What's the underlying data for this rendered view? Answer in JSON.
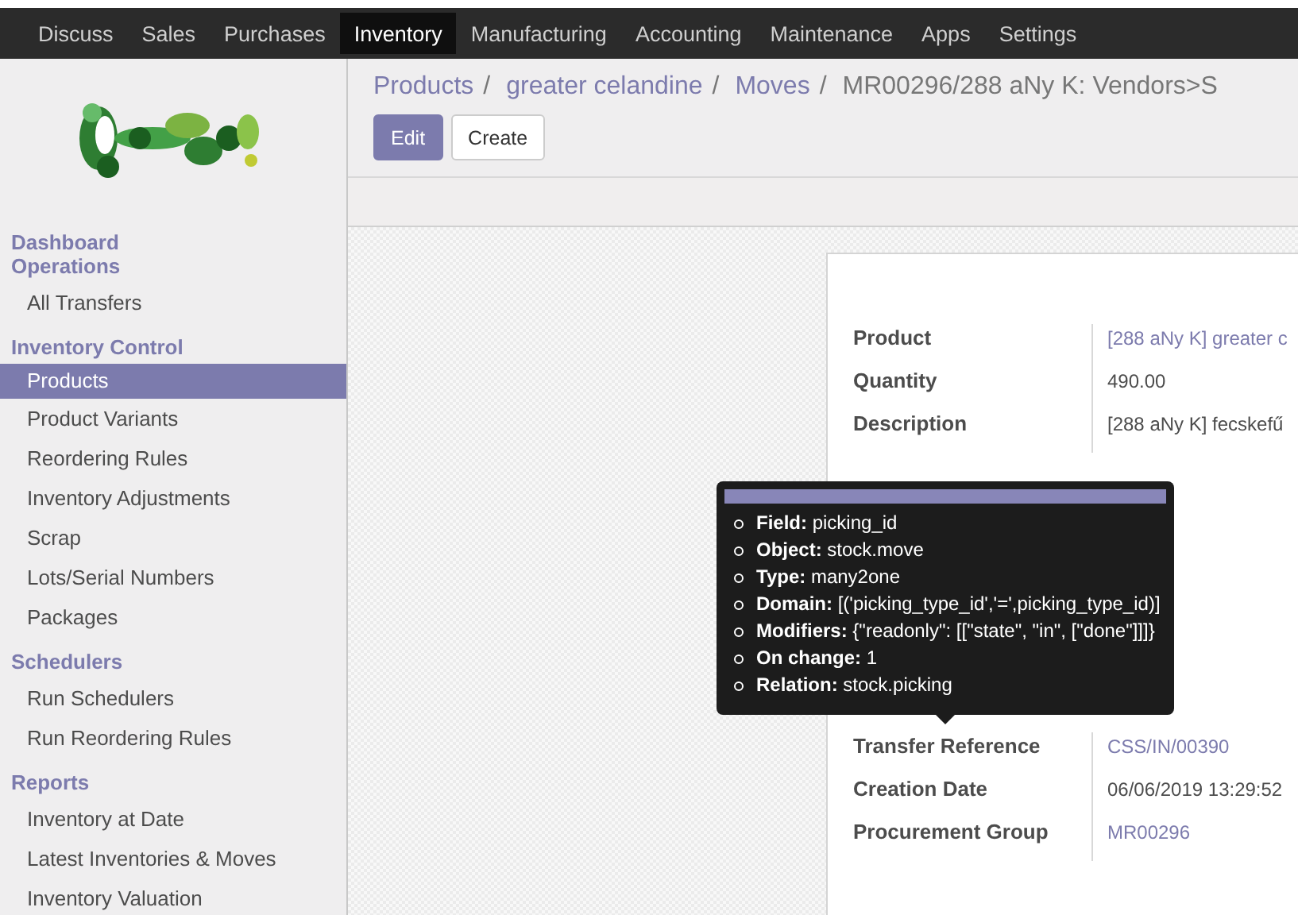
{
  "top_menu": [
    {
      "label": "Discuss",
      "selected": false
    },
    {
      "label": "Sales",
      "selected": false
    },
    {
      "label": "Purchases",
      "selected": false
    },
    {
      "label": "Inventory",
      "selected": true
    },
    {
      "label": "Manufacturing",
      "selected": false
    },
    {
      "label": "Accounting",
      "selected": false
    },
    {
      "label": "Maintenance",
      "selected": false
    },
    {
      "label": "Apps",
      "selected": false
    },
    {
      "label": "Settings",
      "selected": false
    }
  ],
  "sidebar": {
    "sections": [
      {
        "title": "Dashboard"
      },
      {
        "title": "Operations",
        "items": [
          {
            "label": "All Transfers",
            "selected": false
          }
        ]
      },
      {
        "title": "Inventory Control",
        "items": [
          {
            "label": "Products",
            "selected": true
          },
          {
            "label": "Product Variants",
            "selected": false
          },
          {
            "label": "Reordering Rules",
            "selected": false
          },
          {
            "label": "Inventory Adjustments",
            "selected": false
          },
          {
            "label": "Scrap",
            "selected": false
          },
          {
            "label": "Lots/Serial Numbers",
            "selected": false
          },
          {
            "label": "Packages",
            "selected": false
          }
        ]
      },
      {
        "title": "Schedulers",
        "items": [
          {
            "label": "Run Schedulers",
            "selected": false
          },
          {
            "label": "Run Reordering Rules",
            "selected": false
          }
        ]
      },
      {
        "title": "Reports",
        "items": [
          {
            "label": "Inventory at Date",
            "selected": false
          },
          {
            "label": "Latest Inventories & Moves",
            "selected": false
          },
          {
            "label": "Inventory Valuation",
            "selected": false
          }
        ]
      }
    ]
  },
  "breadcrumb": [
    {
      "label": "Products",
      "kind": "link"
    },
    {
      "label": "/",
      "kind": "separator"
    },
    {
      "label": "greater celandine",
      "kind": "link"
    },
    {
      "label": "/",
      "kind": "separator"
    },
    {
      "label": "Moves",
      "kind": "link"
    },
    {
      "label": "/",
      "kind": "separator"
    },
    {
      "label": "MR00296/288 aNy K: Vendors>S",
      "kind": "current"
    }
  ],
  "buttons": [
    {
      "label": "Edit",
      "kind": "primary"
    },
    {
      "label": "Create",
      "kind": "secondary"
    }
  ],
  "form": {
    "groups": [
      {
        "fields": [
          {
            "label": "Product",
            "value": "[288 aNy K] greater c",
            "kind": "link"
          },
          {
            "label": "Quantity",
            "value": "490.00",
            "kind": "text"
          },
          {
            "label": "Description",
            "value": "[288 aNy K] fecskefű",
            "kind": "text"
          }
        ]
      },
      {
        "fields": [
          {
            "label": "Transfer Reference",
            "value": "CSS/IN/00390",
            "kind": "link"
          },
          {
            "label": "Creation Date",
            "value": "06/06/2019 13:29:52",
            "kind": "text"
          },
          {
            "label": "Procurement Group",
            "value": "MR00296",
            "kind": "link"
          }
        ]
      }
    ]
  },
  "tooltip": {
    "items": [
      {
        "key": "Field:",
        "value": "picking_id"
      },
      {
        "key": "Object:",
        "value": "stock.move"
      },
      {
        "key": "Type:",
        "value": "many2one"
      },
      {
        "key": "Domain:",
        "value": "[('picking_type_id','=',picking_type_id)]"
      },
      {
        "key": "Modifiers:",
        "value": "{\"readonly\": [[\"state\", \"in\", [\"done\"]]]}"
      },
      {
        "key": "On change:",
        "value": "1"
      },
      {
        "key": "Relation:",
        "value": "stock.picking"
      }
    ]
  }
}
